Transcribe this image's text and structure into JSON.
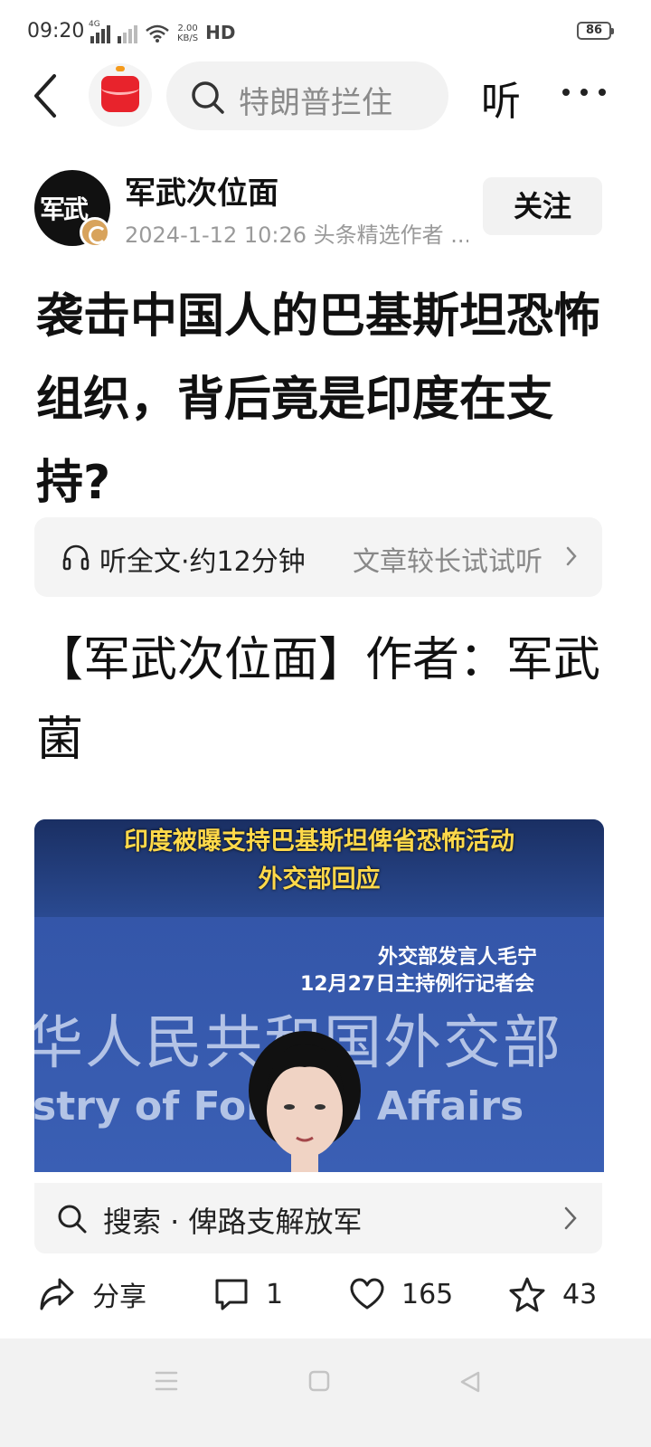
{
  "status_bar": {
    "time": "09:20",
    "network_label": "4G",
    "speed_value": "2.00",
    "speed_unit": "KB/S",
    "hd_label": "HD",
    "battery": "86"
  },
  "header": {
    "search_placeholder": "特朗普拦住",
    "listen_label": "听"
  },
  "author": {
    "name": "军武次位面",
    "meta": "2024-1-12 10:26  头条精选作者 ...",
    "avatar_text": "军武",
    "follow_label": "关注"
  },
  "article": {
    "title": "袭击中国人的巴基斯坦恐怖组织，背后竟是印度在支持?",
    "listen_full": "听全文·约12分钟",
    "listen_hint": "文章较长试试听",
    "body": "【军武次位面】作者：军武菌"
  },
  "image": {
    "headline_1": "印度被曝支持巴基斯坦俾省恐怖活动",
    "headline_2": "外交部回应",
    "caption_1": "外交部发言人毛宁",
    "caption_2": "12月27日主持例行记者会",
    "wall_cn": "华人民共和国外交部",
    "wall_en": "stry of Foreign Affairs"
  },
  "related_search": {
    "text": "搜索 · 俾路支解放军"
  },
  "actions": {
    "share_label": "分享",
    "comment_count": "1",
    "like_count": "165",
    "favorite_count": "43"
  },
  "colors": {
    "accent_red": "#e8232c",
    "badge_gold": "#d8a35c",
    "image_blue": "#3456a9",
    "headline_yellow": "#ffd94a"
  }
}
